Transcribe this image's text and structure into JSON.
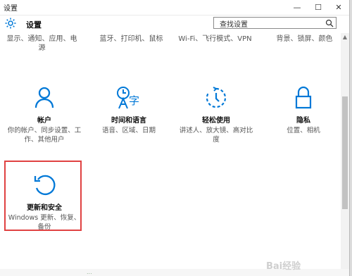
{
  "window": {
    "title": "设置"
  },
  "header": {
    "title": "设置",
    "search_value": "查找设置"
  },
  "top_row": [
    {
      "text": "显示、通知、应用、电源"
    },
    {
      "text": "蓝牙、打印机、鼠标"
    },
    {
      "text": "Wi-Fi、飞行模式、VPN"
    },
    {
      "text": "背景、锁屏、颜色"
    }
  ],
  "tiles": [
    {
      "title": "帐户",
      "desc": "你的帐户、同步设置、工作、其他用户",
      "icon": "person-icon"
    },
    {
      "title": "时间和语言",
      "desc": "语音、区域、日期",
      "icon": "time-language-icon"
    },
    {
      "title": "轻松使用",
      "desc": "讲述人、放大镜、高对比度",
      "icon": "ease-of-access-icon"
    },
    {
      "title": "隐私",
      "desc": "位置、相机",
      "icon": "lock-icon"
    },
    {
      "title": "更新和安全",
      "desc": "Windows 更新、恢复、备份",
      "icon": "update-icon"
    }
  ],
  "watermark": "Bai经验",
  "bottom_text": "...",
  "colors": {
    "accent": "#0078d7",
    "highlight": "#e04141"
  }
}
